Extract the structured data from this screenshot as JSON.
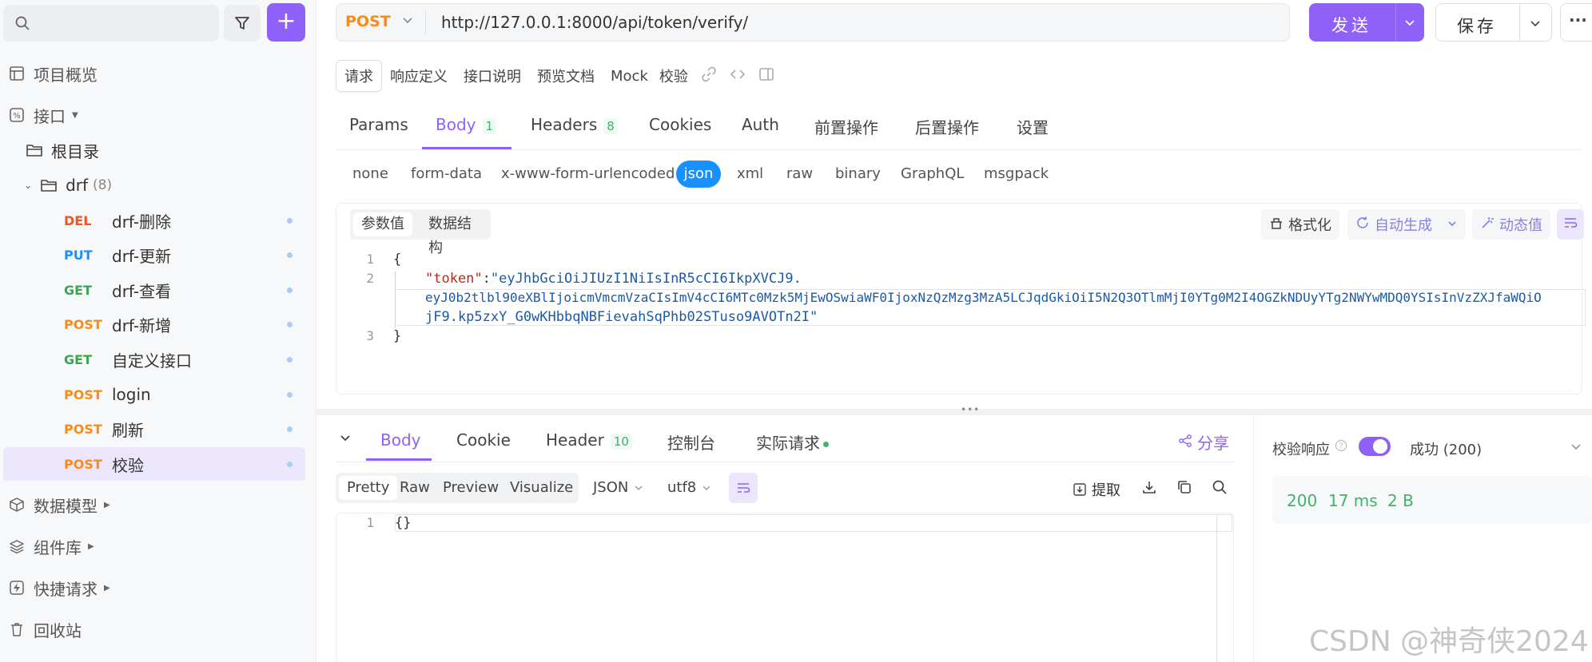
{
  "sidebar": {
    "search_placeholder": "",
    "add_label": "+",
    "nav": {
      "overview": "项目概览",
      "api": "接口",
      "root": "根目录",
      "folder_name": "drf",
      "folder_count": "(8)",
      "data_model": "数据模型",
      "components": "组件库",
      "quick_request": "快捷请求",
      "trash": "回收站"
    },
    "endpoints": [
      {
        "method": "DEL",
        "name": "drf-删除",
        "color": "#f5541f"
      },
      {
        "method": "PUT",
        "name": "drf-更新",
        "color": "#1890ff"
      },
      {
        "method": "GET",
        "name": "drf-查看",
        "color": "#3aa653"
      },
      {
        "method": "POST",
        "name": "drf-新增",
        "color": "#fa8c16"
      },
      {
        "method": "GET",
        "name": "自定义接口",
        "color": "#3aa653"
      },
      {
        "method": "POST",
        "name": "login",
        "color": "#fa8c16"
      },
      {
        "method": "POST",
        "name": "刷新",
        "color": "#fa8c16"
      },
      {
        "method": "POST",
        "name": "校验",
        "color": "#fa8c16",
        "active": true
      }
    ]
  },
  "request": {
    "method": "POST",
    "url": "http://127.0.0.1:8000/api/token/verify/",
    "send_label": "发送",
    "save_label": "保存",
    "more_label": "···"
  },
  "mode_tabs": [
    "请求",
    "响应定义",
    "接口说明",
    "预览文档",
    "Mock",
    "校验"
  ],
  "req_tabs": {
    "params": "Params",
    "body": "Body",
    "body_count": "1",
    "headers": "Headers",
    "headers_count": "8",
    "cookies": "Cookies",
    "auth": "Auth",
    "pre": "前置操作",
    "post": "后置操作",
    "settings": "设置"
  },
  "body_types": [
    "none",
    "form-data",
    "x-www-form-urlencoded",
    "json",
    "xml",
    "raw",
    "binary",
    "GraphQL",
    "msgpack"
  ],
  "editor": {
    "toggle_values": "参数值",
    "toggle_schema": "数据结构",
    "format_label": "格式化",
    "autogen_label": "自动生成",
    "dynamic_label": "动态值",
    "line_numbers": [
      "1",
      "2",
      "3"
    ],
    "line1": "{",
    "line2_key": "\"token\"",
    "line2_colon": ":",
    "line2_part1": "\"eyJhbGciOiJIUzI1NiIsInR5cCI6IkpXVCJ9.",
    "line2_part2": "eyJ0b2tlbl90eXBlIjoicmVmcmVzaCIsImV4cCI6MTc0Mzk5MjEwOSwiaWF0IjoxNzQzMzg3MzA5LCJqdGkiOiI5N2Q3OTlmMjI0YTg0M2I4OGZkNDUyYTg2NWYwMDQ0YSIsInVzZXJfaWQiO",
    "line2_part3": "jF9.kp5zxY_G0wKHbbqNBFievahSqPhb02STuso9AVOTn2I\"",
    "line3": "}"
  },
  "response": {
    "tabs": {
      "body": "Body",
      "cookie": "Cookie",
      "header": "Header",
      "header_count": "10",
      "console": "控制台",
      "actual": "实际请求"
    },
    "share_label": "分享",
    "views": [
      "Pretty",
      "Raw",
      "Preview",
      "Visualize"
    ],
    "format": "JSON",
    "encoding": "utf8",
    "extract_label": "提取",
    "line_number": "1",
    "content": "{}"
  },
  "validation": {
    "label": "校验响应",
    "status": "成功 (200)",
    "code": "200",
    "time": "17 ms",
    "size": "2 B"
  },
  "watermark": "CSDN @神奇侠2024",
  "colors": {
    "accent": "#9061f9",
    "post": "#fa8c16",
    "get": "#3aa653",
    "put": "#1890ff",
    "del": "#f5541f",
    "success": "#3fb36b"
  }
}
